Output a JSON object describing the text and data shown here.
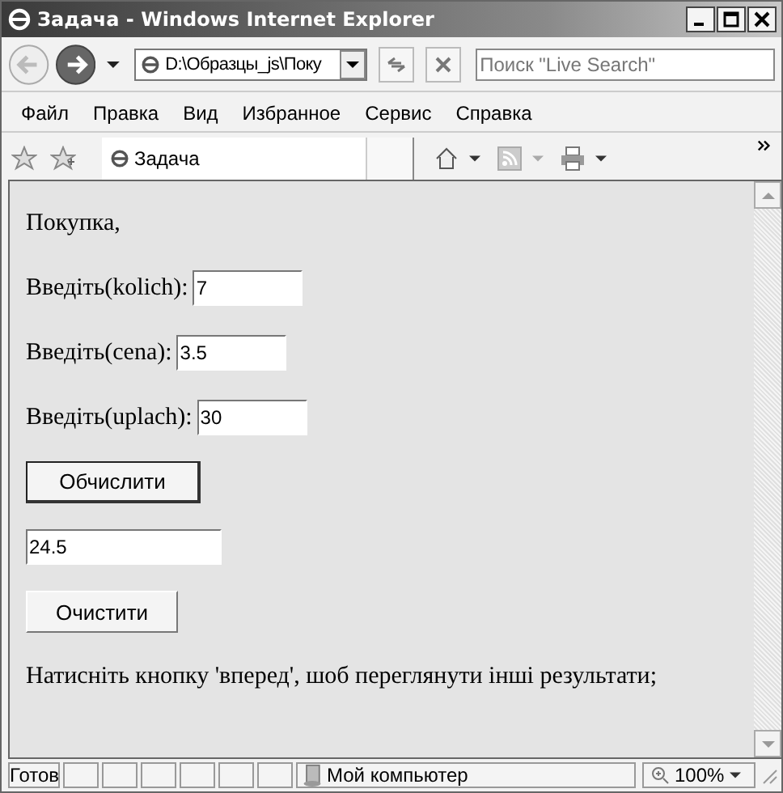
{
  "window": {
    "title": "Задача - Windows Internet Explorer"
  },
  "address": {
    "value": "D:\\Образцы_js\\Поку"
  },
  "search": {
    "placeholder": "Поиск \"Live Search\""
  },
  "menu": [
    "Файл",
    "Правка",
    "Вид",
    "Избранное",
    "Сервис",
    "Справка"
  ],
  "tab": {
    "title": "Задача"
  },
  "content": [
    {
      "kind": "text",
      "text": "Покупка,"
    },
    {
      "kind": "field",
      "label": "Введіть(kolich):",
      "value": "7"
    },
    {
      "kind": "field",
      "label": "Введіть(cena):",
      "value": "3.5"
    },
    {
      "kind": "field",
      "label": "Введіть(uplach):",
      "value": "30"
    },
    {
      "kind": "button",
      "label": "Обчислити",
      "focused": true
    },
    {
      "kind": "output",
      "value": "24.5"
    },
    {
      "kind": "button",
      "label": "Очистити",
      "focused": false
    },
    {
      "kind": "text",
      "text": "Натисніть кнопку 'вперед', шоб переглянути інші результати;"
    }
  ],
  "status_bar": {
    "text": "Готов",
    "zone": "Мой компьютер",
    "zoom": "100%"
  }
}
